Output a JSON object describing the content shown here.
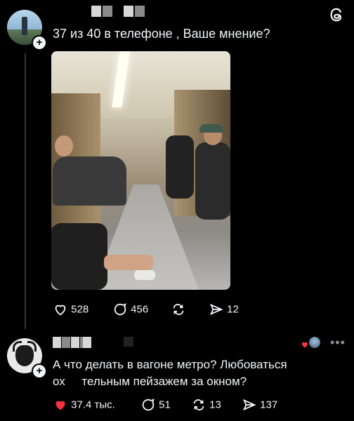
{
  "logo": {
    "icon": "threads-logo-icon"
  },
  "post": {
    "text": "37 из 40 в телефоне , Ваше мнение?",
    "actions": {
      "likes": "528",
      "comments": "456",
      "reposts": "",
      "shares": "12"
    }
  },
  "comment": {
    "line1": "А что делать в вагоне метро? Любоваться",
    "line2": "ох     тельным пейзажем за окном?",
    "actions": {
      "likes": "37.4 тыс.",
      "comments": "51",
      "reposts": "13",
      "shares": "137"
    },
    "more_icon": "•••"
  },
  "colors": {
    "background": "#000000",
    "text": "#f3f5f7",
    "like_red": "#ff3040"
  }
}
